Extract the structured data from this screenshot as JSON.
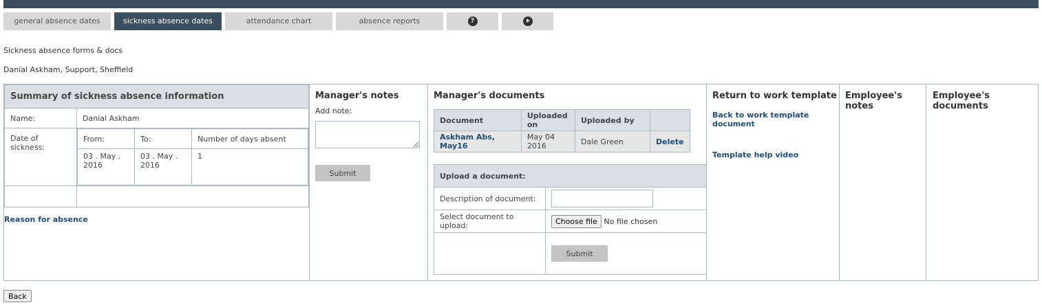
{
  "tabs": {
    "general": "general absence dates",
    "sickness": "sickness absence dates",
    "attendance": "attendance chart",
    "reports": "absence reports",
    "help_icon": "question-circle-icon",
    "video_icon": "play-circle-icon"
  },
  "page": {
    "subtitle": "Sickness absence forms & docs",
    "employee_line": "Danial Askham, Support, Sheffield"
  },
  "summary": {
    "title": "Summary of sickness absence information",
    "name_label": "Name:",
    "name_value": "Danial Askham",
    "date_label": "Date of sickness:",
    "from_label": "From:",
    "to_label": "To:",
    "days_label": "Number of days absent",
    "from_value": "03 . May . 2016",
    "to_value": "03 . May . 2016",
    "days_value": "1",
    "reason_link": "Reason for absence"
  },
  "manager_notes": {
    "title": "Manager's notes",
    "add_note_label": "Add note:",
    "submit": "Submit"
  },
  "manager_docs": {
    "title": "Manager's documents",
    "headers": {
      "document": "Document",
      "uploaded_on": "Uploaded on",
      "uploaded_by": "Uploaded by"
    },
    "rows": [
      {
        "document": "Askham Abs, May16",
        "uploaded_on": "May 04 2016",
        "uploaded_by": "Dale Green",
        "action": "Delete"
      }
    ],
    "upload": {
      "title": "Upload a document:",
      "description_label": "Description of document:",
      "select_label": "Select document to upload:",
      "choose_file": "Choose file",
      "no_file": "No file chosen",
      "submit": "Submit"
    }
  },
  "rtw": {
    "title": "Return to work template",
    "template_link": "Back to work template document",
    "help_video_link": "Template help video"
  },
  "employee_notes": {
    "title": "Employee's notes"
  },
  "employee_docs": {
    "title": "Employee's documents"
  },
  "footer": {
    "back": "Back"
  }
}
